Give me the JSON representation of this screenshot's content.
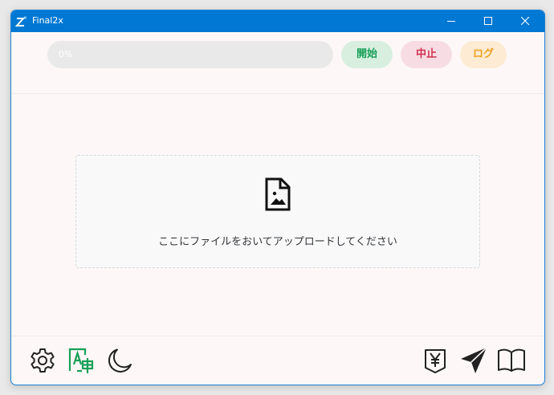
{
  "window": {
    "title": "Final2x"
  },
  "titlebar": {
    "minimize_icon": "minimize-icon",
    "maximize_icon": "maximize-icon",
    "close_icon": "close-icon"
  },
  "toolbar": {
    "progress_label": "0%",
    "progress_value": 0,
    "start_label": "開始",
    "stop_label": "中止",
    "log_label": "ログ"
  },
  "dropzone": {
    "icon": "image-file-icon",
    "text": "ここにファイルをおいてアップロードしてください"
  },
  "bottombar": {
    "left_icons": [
      "gear-icon",
      "translate-icon",
      "moon-icon"
    ],
    "right_icons": [
      "yen-icon",
      "send-icon",
      "book-icon"
    ]
  },
  "colors": {
    "titlebar": "#0078d4",
    "start": "#18a058",
    "stop": "#d03050",
    "log": "#f0a020",
    "translate": "#18a058"
  }
}
